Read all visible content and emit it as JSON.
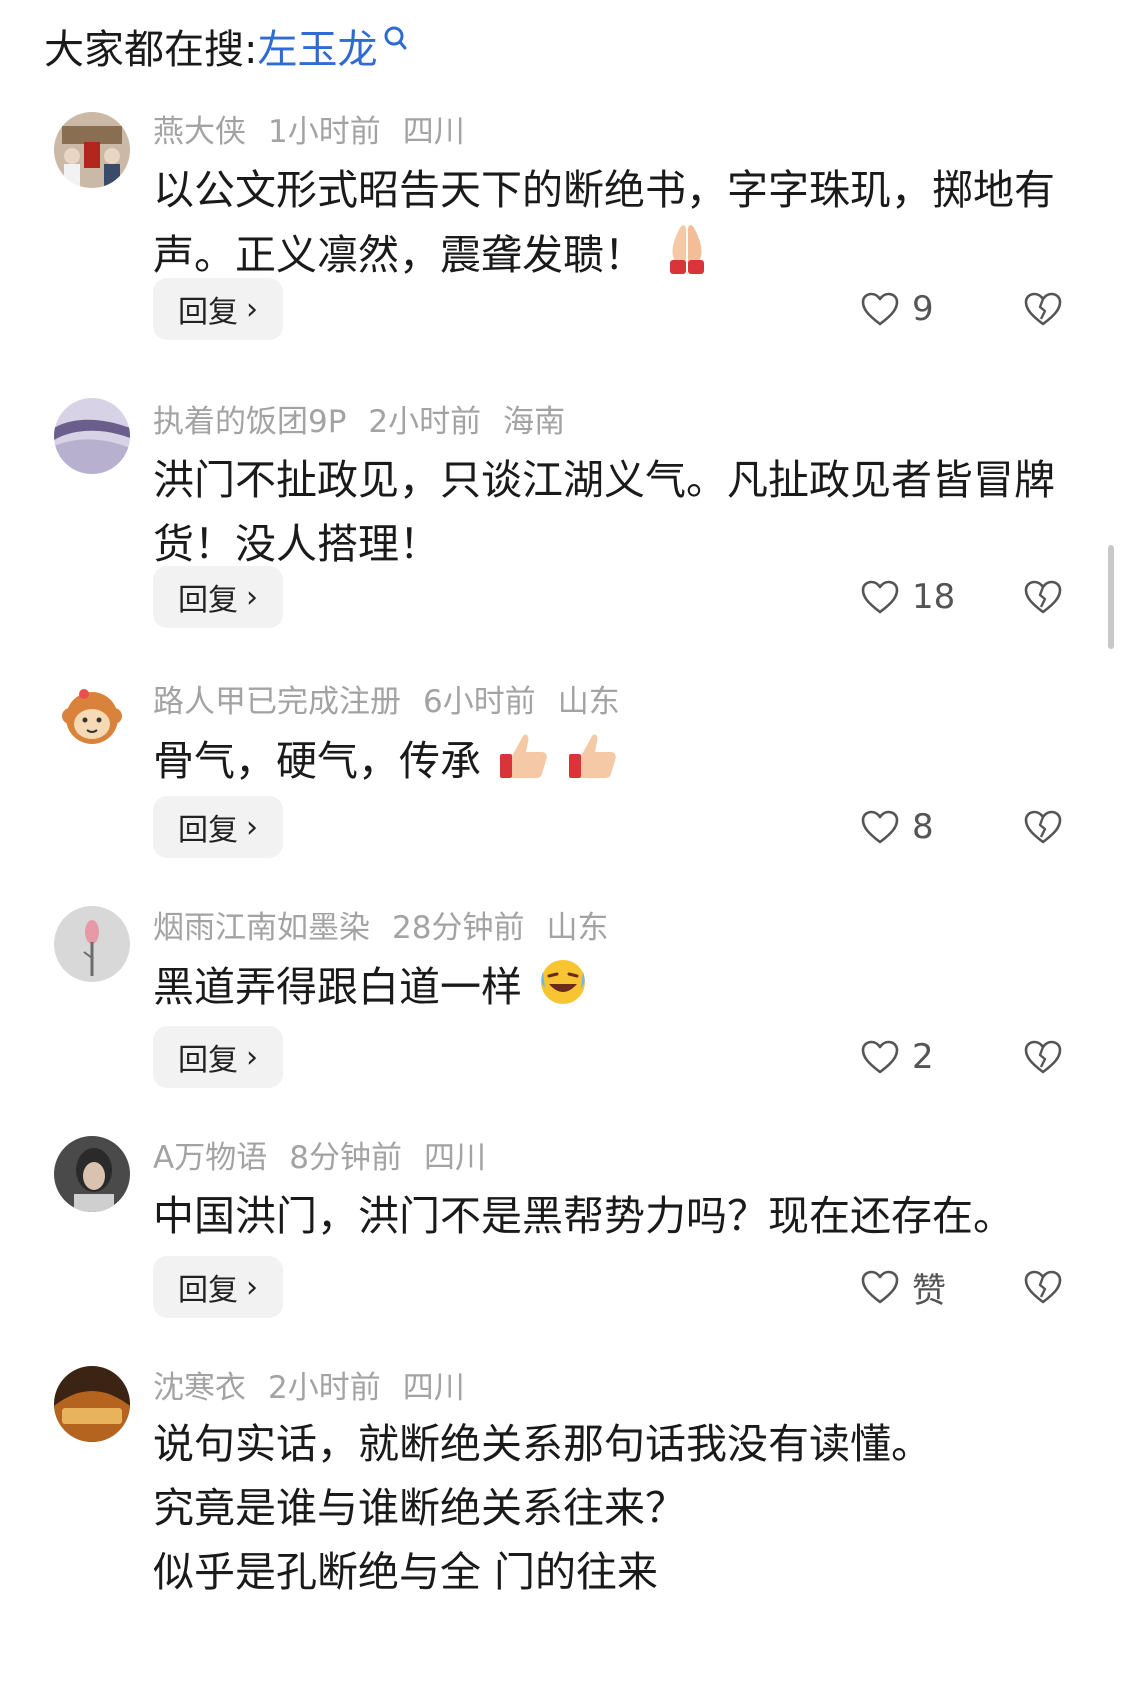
{
  "search": {
    "prefix": "大家都在搜: ",
    "term": "左玉龙",
    "icon": "search-icon"
  },
  "comments": [
    {
      "user": "燕大侠",
      "time": "1小时前",
      "location": "四川",
      "body": "以公文形式昭告天下的断绝书，字字珠玑，掷地有声。正义凛然，震聋发聩！",
      "emoji": "praying-hands-emoji",
      "reply": "回复",
      "likes": "9"
    },
    {
      "user": "执着的饭团9P",
      "time": "2小时前",
      "location": "海南",
      "body": "洪门不扯政见，只谈江湖义气。凡扯政见者皆冒牌货！没人搭理！",
      "reply": "回复",
      "likes": "18"
    },
    {
      "user": "路人甲已完成注册",
      "time": "6小时前",
      "location": "山东",
      "body": "骨气，硬气，传承",
      "emoji": "thumbs-up-emoji",
      "reply": "回复",
      "likes": "8"
    },
    {
      "user": "烟雨江南如墨染",
      "time": "28分钟前",
      "location": "山东",
      "body": "黑道弄得跟白道一样",
      "emoji": "rolling-laughing-emoji",
      "reply": "回复",
      "likes": "2"
    },
    {
      "user": "A万物语",
      "time": "8分钟前",
      "location": "四川",
      "body": "中国洪门，洪门不是黑帮势力吗？现在还存在。",
      "reply": "回复",
      "likes": "赞"
    },
    {
      "user": "沈寒衣",
      "time": "2小时前",
      "location": "四川",
      "body_lines": [
        "说句实话，就断绝关系那句话我没有读懂。",
        "究竟是谁与谁断绝关系往来？",
        "似乎是孔断绝与全    门的往来"
      ]
    }
  ],
  "icons": {
    "like": "heart-outline-icon",
    "dislike": "broken-heart-icon",
    "chevron": "chevron-right-icon"
  }
}
